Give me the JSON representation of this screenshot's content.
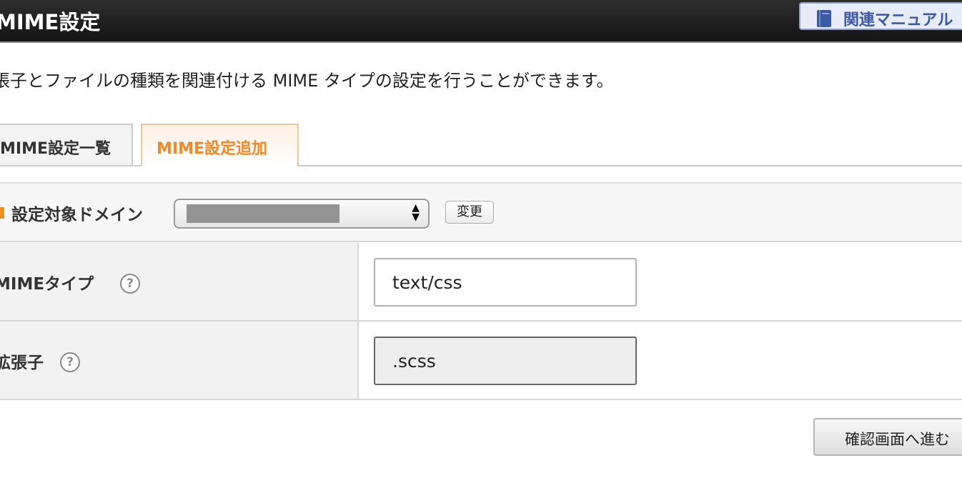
{
  "header": {
    "title": "MIME設定",
    "manual_button_label": "関連マニュアル",
    "manual_icon": "book-icon"
  },
  "description": "張子とファイルの種類を関連付ける MIME タイプの設定を行うことができます。",
  "tabs": [
    {
      "label": "MIME設定一覧",
      "active": false
    },
    {
      "label": "MIME設定追加",
      "active": true
    }
  ],
  "domain": {
    "label": "設定対象ドメイン",
    "change_button_label": "変更"
  },
  "form": {
    "mime_type": {
      "label": "MIMEタイプ",
      "help_symbol": "?",
      "value": "text/css"
    },
    "extension": {
      "label": "拡張子",
      "help_symbol": "?",
      "value": ".scss"
    }
  },
  "submit_button_label": "確認画面へ進む",
  "colors": {
    "header_bg": "#1e1e1e",
    "accent_orange": "#ec8a2c",
    "manual_blue": "#3b5aa6"
  }
}
